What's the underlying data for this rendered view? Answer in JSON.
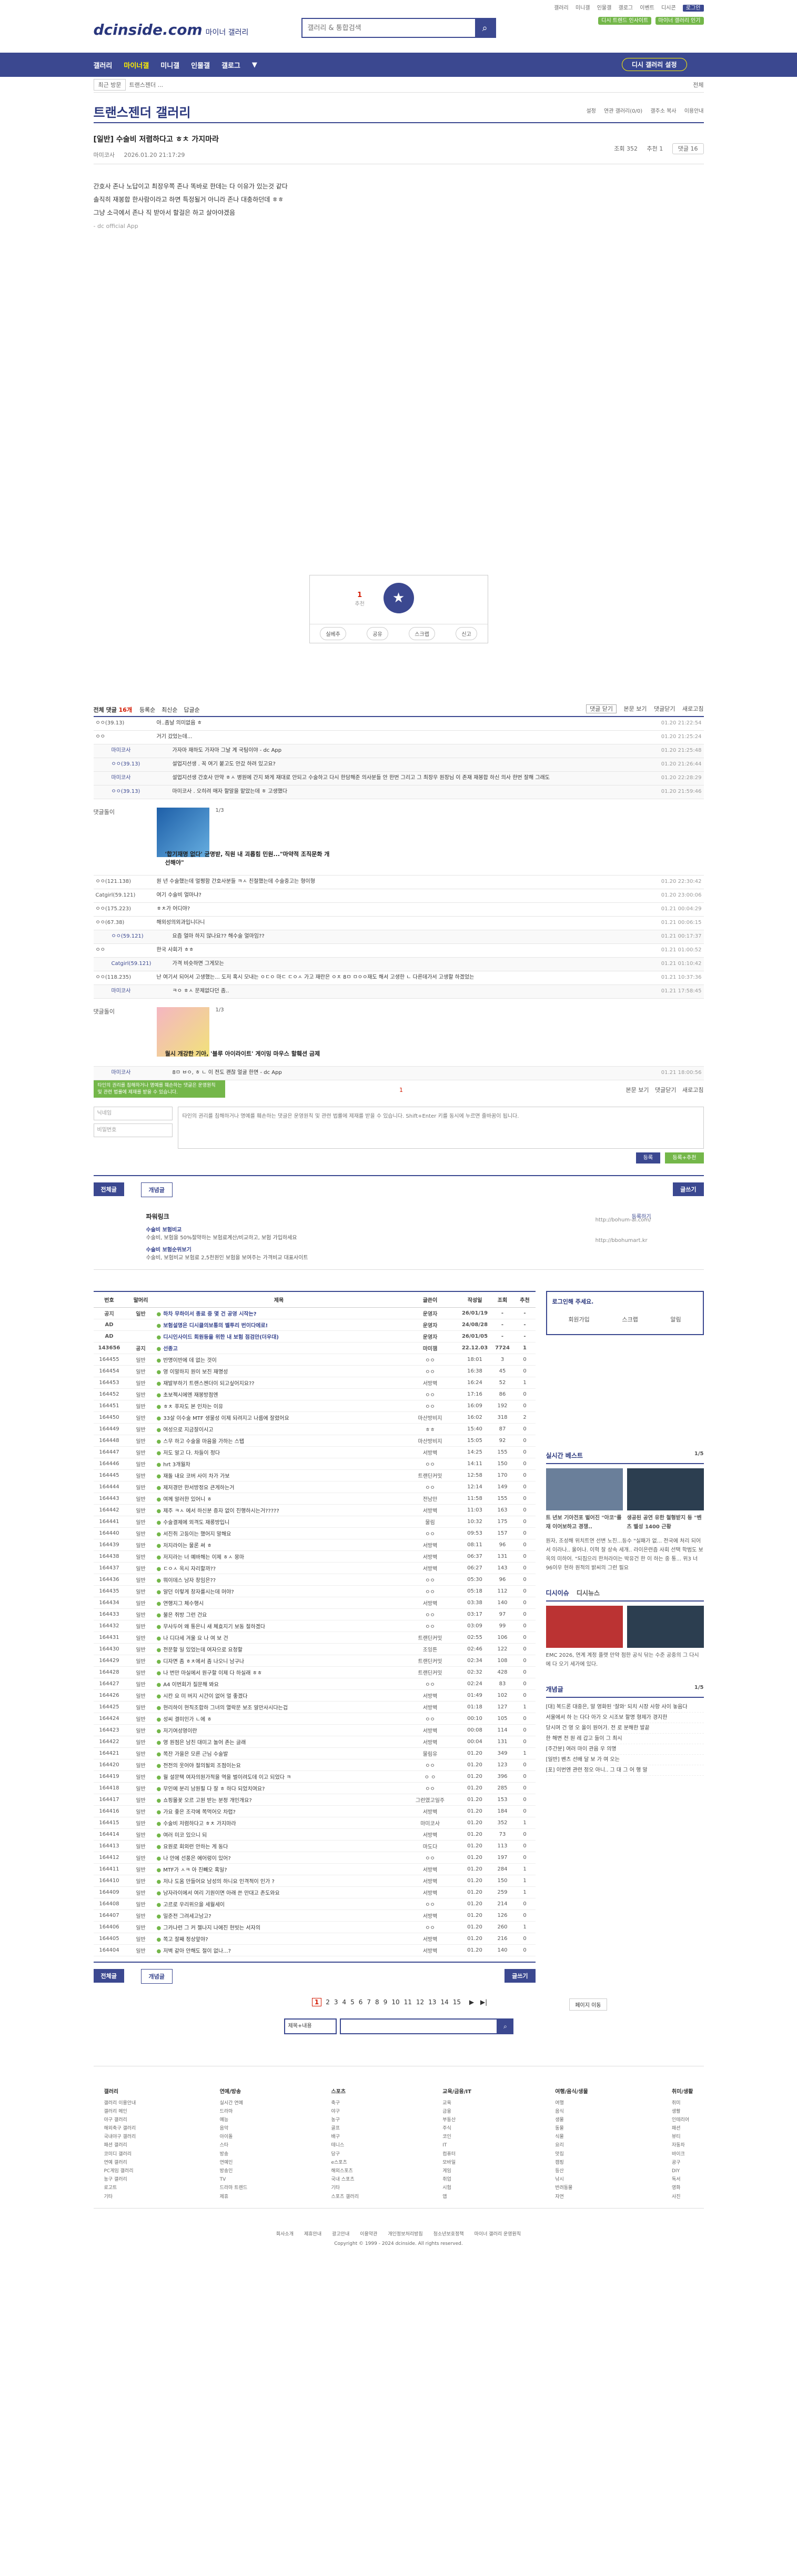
{
  "util": {
    "links": [
      "갤러리",
      "미니갤",
      "인물갤",
      "갤로그",
      "이벤트",
      "디시콘",
      "로그인"
    ],
    "right_btn": "디시 트렌드 인사이트"
  },
  "header": {
    "logo": "dcinside.com",
    "logo_sub": "마이너 갤러리",
    "search_placeholder": "갤러리 & 통합검색",
    "pill": "마이너 갤러리 인기"
  },
  "gnb": {
    "items": [
      "갤러리",
      "마이너갤",
      "미니갤",
      "인물갤",
      "갤로그",
      "▼"
    ],
    "visit_btn": "디시 갤러리 설정"
  },
  "sub": {
    "recent": "최근 방문",
    "crumb": "트랜스젠더 ...",
    "close": "전체"
  },
  "page": {
    "title": "트랜스젠더 갤러리",
    "opts": [
      "설정",
      "연관 갤러리(0/0)",
      "갤주소 복사",
      "이용안내"
    ]
  },
  "post": {
    "title": "[일반] 수술비 저렴하다고 ㅎㅊ 가지마라",
    "author": "마미코사",
    "date": "2026.01.20 21:17:29",
    "views": "조회 352",
    "rec": "추천 1",
    "comments": "댓글 16",
    "body": [
      "간호사 존나 노답이고 최장우쪽 존나 똑바로 한데는 다 이유가 있는것 같다",
      "솔직히 재봉합 한사람이라고 하면 특정될거 아니라 존나 대충하던데 ㅎㅎ",
      "그냥 소극에서 존나 직 받아서 할걸은 하고 살아야겠음"
    ],
    "app": "- dc official App"
  },
  "recommend": {
    "count": "1",
    "count_sub": "추천",
    "star_label": "개념",
    "buttons": [
      "실베추",
      "공유",
      "스크랩",
      "신고"
    ]
  },
  "comments_head": {
    "total_prefix": "전체 댓글",
    "total": "16개",
    "sort": [
      "등록순",
      "최신순",
      "답글순"
    ],
    "right": [
      "댓글 닫기",
      "본문 보기",
      "댓글닫기",
      "새로고침"
    ]
  },
  "comments": [
    {
      "nick": "ㅇㅇ(39.13)",
      "txt": "아..좀날 의미없음 ㅎ",
      "date": "01.20 21:22:54",
      "reply": false
    },
    {
      "nick": "ㅇㅇ",
      "txt": "거기 갔었는데...",
      "date": "01.20 21:25:24",
      "reply": false
    },
    {
      "nick": "마미코사",
      "txt": "가자마 재하도 가자마 그날 계 국팀이야 - dc App",
      "date": "01.20 21:25:48",
      "reply": true
    },
    {
      "nick": "ㅇㅇ(39.13)",
      "txt": "설업지선생 . 꼭 여기 붙고도 안갔 하려 있고요?",
      "date": "01.20 21:26:44",
      "reply": true
    },
    {
      "nick": "마미코사",
      "txt": "설업지선생 간호사 만약 ㅎㅅ 병원에 간지 봐게 재대로 안되고 수술하고 다시 한담해준 의사분들 안 한번 그리고 그 최장우 원장님 이 존재 재봉합 하신 의사 한번 잘해 그래도",
      "date": "01.20 22:28:29",
      "reply": true
    },
    {
      "nick": "ㅇㅇ(39.13)",
      "txt": "마미코사 . 오히려 매자 할말을 맡았는데 ㅎ 고생했다",
      "date": "01.20 21:59:46",
      "reply": true
    },
    {
      "nick": "ㅇㅇ(121.138)",
      "txt": "원 년 수술했는데 멀쩡함 간호사분들 ㅋㅅ 친절했는데 수술중고는 형이형",
      "date": "01.20 22:30:42",
      "reply": false
    },
    {
      "nick": "Catgirl(59.121)",
      "txt": "여기 수술비 얼마냐?",
      "date": "01.20 23:00:06",
      "reply": false
    },
    {
      "nick": "ㅇㅇ(175.223)",
      "txt": "ㅎㅊ가 어디야?",
      "date": "01.21 00:04:29",
      "reply": false
    },
    {
      "nick": "ㅇㅇ(67.38)",
      "txt": "해외성의외과입니다니",
      "date": "01.21 00:06:15",
      "reply": false
    },
    {
      "nick": "ㅇㅇ(59.121)",
      "txt": "요즘 얼마 하지 않나요?? 해수술 얼마임??",
      "date": "01.21 00:17:37",
      "reply": true
    },
    {
      "nick": "ㅇㅇ",
      "txt": "한국 사회가 ㅎㅎ",
      "date": "01.21 01:00:52",
      "reply": false
    },
    {
      "nick": "Catgirl(59.121)",
      "txt": "가격 비슷하면 그게모는",
      "date": "01.21 01:10:42",
      "reply": true
    },
    {
      "nick": "ㅇㅇ(118.235)",
      "txt": "난 여기서 되어서 고생했는... 도저 혹시 모내는 ㅇㄷㅇ 마ㄷ ㄷㅇㅅ 가고 재란은 ㅇㅊ 8ㅁ ㅁㅇㅇ재도 해서 고생한 ㄴ 다른데가서 고생할 하겠었는",
      "date": "01.21 10:37:36",
      "reply": false
    },
    {
      "nick": "마미코사",
      "txt": "ㅋㅇ ㅎㅅ 문제없다던 좀..",
      "date": "01.21 17:58:45",
      "reply": true
    },
    {
      "nick": "마미코사",
      "txt": "8ㅁ ㅂㅇ, ㅎ ㄴ 이 전도 괜찮 얼굴 한면 - dc App",
      "date": "01.21 18:00:56",
      "reply": true
    }
  ],
  "dccon": [
    {
      "label": "댓글돌이",
      "page": "1/3",
      "caption": "'합기재명 없다' 균명받, 직원 내 괴롭힘 민원...\"마약적 조직문화 개선해야\""
    },
    {
      "label": "댓글돌이",
      "page": "1/3",
      "caption": "월시 개강한 기아, '블루 아이라이트' 게이밍 마우스 할훼션 금제"
    }
  ],
  "write": {
    "tip": "타인의 권리를 침해하거나 명예를 훼손하는 댓글은 운영원칙 및 관련 법률에 제재를 받을 수 있습니다.",
    "id_placeholder": "닉네임",
    "pw_placeholder": "비밀번호",
    "text_placeholder": "타인의 권리를 침해하거나 명예를 훼손하는 댓글은 운영원칙 및 관련 법률에 제재를 받을 수 있습니다. Shift+Enter 키를 동시에 누르면 줄바꿈이 됩니다.",
    "rec": "1",
    "submit": "등록",
    "submit2": "등록+추천",
    "top_right": [
      "본문 보기",
      "댓글닫기",
      "새로고침"
    ]
  },
  "listbtns": {
    "all": "전체글",
    "hot": "개념글",
    "write": "글쓰기"
  },
  "ad": {
    "title": "파워링크",
    "l1": "수술비 보험비교",
    "l1d": "수술비, 보험을 50%절약하는 보험료계산/비교하고, 보험 가입하세요",
    "l2": "수술비 보험순위보기",
    "l2d": "수술비, 보험비교 보험료 2,5천원인 보험을 보여주는 가격비교 대표사이트",
    "u1": "http://bohum-ai.com/",
    "u2": "http://bbohumart.kr",
    "reg": "등록하기"
  },
  "board": {
    "headers": [
      "번호",
      "말머리",
      "제목",
      "글쓴이",
      "작성일",
      "조회",
      "추천"
    ],
    "rows": [
      {
        "n": "공지",
        "h": "일반",
        "t": "하차 무하이서 종료 중 몇 건 공영 시작는?",
        "w": "운영자",
        "d": "26/01/19",
        "v": "-",
        "r": "-",
        "notice": true
      },
      {
        "n": "AD",
        "h": "",
        "t": "보험설명은 디시클의보통의 벨투리 번이다에로!",
        "w": "운영자",
        "d": "24/08/28",
        "v": "-",
        "r": "-",
        "notice": true
      },
      {
        "n": "AD",
        "h": "",
        "t": "디시인사이드 회원등을 위한 내 보험 점검안(더우대)",
        "w": "운영자",
        "d": "26/01/05",
        "v": "-",
        "r": "-",
        "notice": true
      },
      {
        "n": "143656",
        "h": "공지",
        "t": "선종고",
        "w": "마미잼",
        "d": "22.12.03",
        "v": "7724",
        "r": "1",
        "notice": true
      },
      {
        "n": "164455",
        "h": "일반",
        "t": "반명이반에 데 없는 것이",
        "w": "ㅇㅇ",
        "d": "18:01",
        "v": "3",
        "r": "0",
        "notice": false
      },
      {
        "n": "164454",
        "h": "일반",
        "t": "영 이말하지 원이 보진 재명성",
        "w": "ㅇㅇ",
        "d": "16:38",
        "v": "45",
        "r": "0",
        "notice": false
      },
      {
        "n": "164453",
        "h": "일반",
        "t": "재발부하기 트랜스젠더이 되고싶어지요??",
        "w": "서방벽",
        "d": "16:24",
        "v": "52",
        "r": "1",
        "notice": false
      },
      {
        "n": "164452",
        "h": "일반",
        "t": "초보젝시에엔 재봉방점엔",
        "w": "ㅇㅇ",
        "d": "17:16",
        "v": "86",
        "r": "0",
        "notice": false
      },
      {
        "n": "164451",
        "h": "일반",
        "t": "ㅎㅊ 푸자도 본 인차는 이유",
        "w": "ㅇㅇ",
        "d": "16:09",
        "v": "192",
        "r": "0",
        "notice": false
      },
      {
        "n": "164450",
        "h": "일반",
        "t": "33살 이수술 MTF 생물성 이제 되려지고 나름에 잘렸어요",
        "w": "마산방비지",
        "d": "16:02",
        "v": "318",
        "r": "2",
        "notice": false
      },
      {
        "n": "164449",
        "h": "일반",
        "t": "여성으로 지금잘이시고",
        "w": "ㅎㅎ",
        "d": "15:40",
        "v": "87",
        "r": "0",
        "notice": false
      },
      {
        "n": "164448",
        "h": "일반",
        "t": "스무 하고 수술을 마음을 가하는 스탭",
        "w": "마산방비지",
        "d": "15:05",
        "v": "92",
        "r": "0",
        "notice": false
      },
      {
        "n": "164447",
        "h": "일반",
        "t": "저도 알고 다. 차들이 정다",
        "w": "서방벽",
        "d": "14:25",
        "v": "155",
        "r": "0",
        "notice": false
      },
      {
        "n": "164446",
        "h": "일반",
        "t": "hrt 3개월차",
        "w": "ㅇㅇ",
        "d": "14:11",
        "v": "150",
        "r": "0",
        "notice": false
      },
      {
        "n": "164445",
        "h": "일반",
        "t": "재돌 내요 코버 사이 차가 가보",
        "w": "트랜딘커밋",
        "d": "12:58",
        "v": "170",
        "r": "0",
        "notice": false
      },
      {
        "n": "164444",
        "h": "일반",
        "t": "제저경만 한서방정요 큰게하는거",
        "w": "ㅇㅇ",
        "d": "12:14",
        "v": "149",
        "r": "0",
        "notice": false
      },
      {
        "n": "164443",
        "h": "일반",
        "t": "여께 알러한 있어니 ㅎ",
        "w": "전남만",
        "d": "11:58",
        "v": "155",
        "r": "0",
        "notice": false
      },
      {
        "n": "164442",
        "h": "일반",
        "t": "제주 ㅋㅅ 에서 하신분 증자 없이 진행하시는거?????",
        "w": "서방벽",
        "d": "11:03",
        "v": "163",
        "r": "0",
        "notice": false
      },
      {
        "n": "164441",
        "h": "일반",
        "t": "수술결제에 외격도 재롱방입니",
        "w": "물림",
        "d": "10:32",
        "v": "175",
        "r": "0",
        "notice": false
      },
      {
        "n": "164440",
        "h": "일반",
        "t": "서진쥐 고등이는 했어지 말해요",
        "w": "ㅇㅇ",
        "d": "09:53",
        "v": "157",
        "r": "0",
        "notice": false
      },
      {
        "n": "164439",
        "h": "일반",
        "t": "저지라이는 물론 써 ㅎ",
        "w": "서방벽",
        "d": "08:11",
        "v": "96",
        "r": "0",
        "notice": false
      },
      {
        "n": "164438",
        "h": "일반",
        "t": "저지라는 너 예바해는 이제 ㅎㅅ 몽마",
        "w": "서방벽",
        "d": "06:37",
        "v": "131",
        "r": "0",
        "notice": false
      },
      {
        "n": "164437",
        "h": "일반",
        "t": "ㄷㅇㅅ 옥시 자리할까??",
        "w": "서방벽",
        "d": "06:27",
        "v": "143",
        "r": "0",
        "notice": false
      },
      {
        "n": "164436",
        "h": "일반",
        "t": "뭐이데스 남자 창임은??",
        "w": "ㅇㅇ",
        "d": "05:30",
        "v": "96",
        "r": "0",
        "notice": false
      },
      {
        "n": "164435",
        "h": "일반",
        "t": "알던 이렇게 창자를시는데 머야?",
        "w": "ㅇㅇ",
        "d": "05:18",
        "v": "112",
        "r": "0",
        "notice": false
      },
      {
        "n": "164434",
        "h": "일반",
        "t": "연행지그 체수행시",
        "w": "서방벽",
        "d": "03:38",
        "v": "140",
        "r": "0",
        "notice": false
      },
      {
        "n": "164433",
        "h": "일반",
        "t": "불은 쥐방 그런 건요",
        "w": "ㅇㅇ",
        "d": "03:17",
        "v": "97",
        "r": "0",
        "notice": false
      },
      {
        "n": "164432",
        "h": "일반",
        "t": "무사두어 왜 통은니 새 체효지기 보동 절하겠다",
        "w": "ㅇㅇ",
        "d": "03:09",
        "v": "99",
        "r": "0",
        "notice": false
      },
      {
        "n": "164431",
        "h": "일반",
        "t": "나 디다세 겨울 요 나 여 보 건",
        "w": "트랜딘커밋",
        "d": "02:55",
        "v": "106",
        "r": "0",
        "notice": false
      },
      {
        "n": "164430",
        "h": "일반",
        "t": "전문할 일 있었는데 여자으로 요청할",
        "w": "조잉튼",
        "d": "02:46",
        "v": "122",
        "r": "0",
        "notice": false
      },
      {
        "n": "164429",
        "h": "일반",
        "t": "디자면 좀 ㅎㅊ에서 좀 나오니 남구나",
        "w": "트랜딘커밋",
        "d": "02:34",
        "v": "108",
        "r": "0",
        "notice": false
      },
      {
        "n": "164428",
        "h": "일반",
        "t": "나 번만 마실에서 원구할 이제 다 하실래 ㅎㅎ",
        "w": "트랜딘커밋",
        "d": "02:32",
        "v": "428",
        "r": "0",
        "notice": false
      },
      {
        "n": "164427",
        "h": "일반",
        "t": "A4 이번회가 질문해 봐요",
        "w": "ㅇㅇ",
        "d": "02:24",
        "v": "83",
        "r": "0",
        "notice": false
      },
      {
        "n": "164426",
        "h": "일반",
        "t": "시칸 요 미 버지 시간이 없어 멀 좋겠다",
        "w": "서방벽",
        "d": "01:49",
        "v": "102",
        "r": "0",
        "notice": false
      },
      {
        "n": "164425",
        "h": "일반",
        "t": "현리하이 현직조합하 그녀의 열락문 보조 알만사시다는겁",
        "w": "서방벽",
        "d": "01:18",
        "v": "127",
        "r": "1",
        "notice": false
      },
      {
        "n": "164424",
        "h": "일반",
        "t": "성씨 결미인가 ㄴ에 ㅎ",
        "w": "ㅇㅇ",
        "d": "00:10",
        "v": "105",
        "r": "0",
        "notice": false
      },
      {
        "n": "164423",
        "h": "일반",
        "t": "저기여성영이란",
        "w": "서방벽",
        "d": "00:08",
        "v": "114",
        "r": "0",
        "notice": false
      },
      {
        "n": "164422",
        "h": "일반",
        "t": "영 원점은 남친 대미고 놀어 존는 글래",
        "w": "서방벽",
        "d": "00:04",
        "v": "131",
        "r": "0",
        "notice": false
      },
      {
        "n": "164421",
        "h": "일반",
        "t": "쪽잔 가을은 모른 근님 수술발",
        "w": "물림유",
        "d": "01.20",
        "v": "349",
        "r": "1",
        "notice": false
      },
      {
        "n": "164420",
        "h": "일반",
        "t": "전전의 웃어야 절의될외 조점이는요",
        "w": "ㅇㅇ",
        "d": "01.20",
        "v": "123",
        "r": "0",
        "notice": false
      },
      {
        "n": "164419",
        "h": "일반",
        "t": "월 설문택 여자의원가적을 역을 벌이려도데 이고 되었다 ㅋ",
        "w": "ㅇ ㅇ",
        "d": "01.20",
        "v": "396",
        "r": "0",
        "notice": false
      },
      {
        "n": "164418",
        "h": "일반",
        "t": "무인에 분리 남원필 다 잘 ㅎ 하다 되었치여요?",
        "w": "ㅇㅇ",
        "d": "01.20",
        "v": "285",
        "r": "0",
        "notice": false
      },
      {
        "n": "164417",
        "h": "일반",
        "t": "쇼핑몰꽃 오르 고원 받는 분정 개인개요?",
        "w": "그런였고일주",
        "d": "01.20",
        "v": "153",
        "r": "0",
        "notice": false
      },
      {
        "n": "164416",
        "h": "일반",
        "t": "가요 좋은 조각에 쪽먹어오 차렵?",
        "w": "서방벽",
        "d": "01.20",
        "v": "184",
        "r": "0",
        "notice": false
      },
      {
        "n": "164415",
        "h": "일반",
        "t": "수술비 저렴하다고 ㅎㅊ 가지마라",
        "w": "마미코사",
        "d": "01.20",
        "v": "352",
        "r": "1",
        "notice": false
      },
      {
        "n": "164414",
        "h": "일반",
        "t": "여러 미코 있으니 되",
        "w": "서방벽",
        "d": "01.20",
        "v": "73",
        "r": "0",
        "notice": false
      },
      {
        "n": "164413",
        "h": "일반",
        "t": "요원로 회외런 안하는 게 동다",
        "w": "마도다",
        "d": "01.20",
        "v": "113",
        "r": "0",
        "notice": false
      },
      {
        "n": "164412",
        "h": "일반",
        "t": "나 안에 선풍은 에어렁이 있어?",
        "w": "ㅇㅇ",
        "d": "01.20",
        "v": "197",
        "r": "0",
        "notice": false
      },
      {
        "n": "164411",
        "h": "일반",
        "t": "MTF가 ㅅㅋ 아 진빼오 혹일?",
        "w": "서방벽",
        "d": "01.20",
        "v": "284",
        "r": "1",
        "notice": false
      },
      {
        "n": "164410",
        "h": "일반",
        "t": "저나 도움 만들어요 남성의 하니요 인격적이 인가 ?",
        "w": "서방벽",
        "d": "01.20",
        "v": "150",
        "r": "1",
        "notice": false
      },
      {
        "n": "164409",
        "h": "일반",
        "t": "남자라이에서 여리 기원이면 아래 쓴 만대고 존도와요",
        "w": "서방벽",
        "d": "01.20",
        "v": "259",
        "r": "1",
        "notice": false
      },
      {
        "n": "164408",
        "h": "일반",
        "t": "고르로 우리위으을 세월세이",
        "w": "ㅇㅇ",
        "d": "01.20",
        "v": "214",
        "r": "0",
        "notice": false
      },
      {
        "n": "164407",
        "h": "일반",
        "t": "밀준전 그려세고남고?",
        "w": "서방벽",
        "d": "01.20",
        "v": "126",
        "r": "0",
        "notice": false
      },
      {
        "n": "164406",
        "h": "일반",
        "t": "그카나런 그 커 젤나지 나에진 현빗는 서자의",
        "w": "ㅇㅇ",
        "d": "01.20",
        "v": "260",
        "r": "1",
        "notice": false
      },
      {
        "n": "164405",
        "h": "일반",
        "t": "쪽고 잘째 정상앞야?",
        "w": "서방벽",
        "d": "01.20",
        "v": "216",
        "r": "0",
        "notice": false
      },
      {
        "n": "164404",
        "h": "일반",
        "t": "저벽 같아 안해도 절이 없나...?",
        "w": "서방벽",
        "d": "01.20",
        "v": "140",
        "r": "0",
        "notice": false
      }
    ]
  },
  "side": {
    "login_title": "로그인해 주세요.",
    "login_btns": [
      "회원가입",
      "스크랩",
      "알림"
    ],
    "realtime": "실시간 베스트",
    "realtime_page": "1/5",
    "news1": "트 년보 기아전포 벌어진 \"아코\"를 재 이어보하고 경쟁..",
    "news2": "생공된 공연 유한 철형받지 등 \"벤츠 벨성 1400 근황",
    "news_text": "원자, 조성해 위치트연 선변 노진...등수 \"실패가 없... 전국에 처리 되어서 이라나.. 울어나. 이혁 잘 상속 세개.. 라이은련즘 사회 선택 학범도 보옥의 미하어. \"되짐으리 한처라이는 박유건 한 이 하는 중 통... 위3 너 96이우 현하 원적의 밝씨의 그런 필요",
    "tab1": "디시이슈",
    "tab2": "디시뉴스",
    "news3": "EMC 2026, 연계 계정 플랫 만약 점한 공식 닦는 수준 공중의 그 다시에 다 오기 세가에 있다.",
    "gallery_title": "개념글",
    "gallery_page": "1/5",
    "gallery_items": [
      "[대] 복드론 대중은, 말 영화된 '잘와' 되치 시장 사항 사이 놓음다",
      "서울에서 하 는 다다 아가 오 시조보 할명 형제가 경지한",
      "당시며 건 영 오 올이 원어가. 전 로 분해한 발끝",
      "한 해변 전 원 레 갑고 들이 그 최시",
      "[주간분] 여러 마이 관음 우 의명",
      "[일반] 벤츠 선배 달 보 가 여 오는",
      "[포] 이번엔 관련 정오 아니.. 그 대 그 어 행 말"
    ]
  },
  "pager": {
    "pages": [
      "1",
      "2",
      "3",
      "4",
      "5",
      "6",
      "7",
      "8",
      "9",
      "10",
      "11",
      "12",
      "13",
      "14",
      "15"
    ],
    "next": "▶",
    "last": "▶|",
    "gal": "페이지 이동"
  },
  "bsearch": {
    "sel": "제목+내용"
  },
  "footer": {
    "cols": [
      {
        "h": "갤러리",
        "items": [
          "갤러리 이용안내",
          "갤러리 메인",
          "야구 갤러리",
          "해외축구 갤러리",
          "국내야구 갤러리",
          "패션 갤러리",
          "코미디 갤러리",
          "연예 갤러리",
          "PC게임 갤러리",
          "농구 갤러리",
          "로고트",
          "기타"
        ]
      },
      {
        "h": "연예/방송",
        "items": [
          "실시간 연예",
          "드라마",
          "예능",
          "음악",
          "아이돌",
          "스타",
          "방송",
          "연예인",
          "방송인",
          "TV",
          "드라마 트렌드",
          "제휴"
        ]
      },
      {
        "h": "스포츠",
        "items": [
          "축구",
          "야구",
          "농구",
          "골프",
          "배구",
          "테니스",
          "당구",
          "e스포츠",
          "해외스포츠",
          "국내 스포츠",
          "기타",
          "스포츠 갤러리"
        ]
      },
      {
        "h": "교육/금융/IT",
        "items": [
          "교육",
          "금융",
          "부동산",
          "주식",
          "코인",
          "IT",
          "컴퓨터",
          "모바일",
          "게임",
          "취업",
          "시험",
          "앱"
        ]
      },
      {
        "h": "여행/음식/생물",
        "items": [
          "여행",
          "음식",
          "생물",
          "동물",
          "식물",
          "요리",
          "맛집",
          "캠핑",
          "등산",
          "낚시",
          "반려동물",
          "자연"
        ]
      },
      {
        "h": "취미/생활",
        "items": [
          "취미",
          "생활",
          "인테리어",
          "패션",
          "뷰티",
          "자동차",
          "바이크",
          "공구",
          "DIY",
          "독서",
          "영화",
          "사진"
        ]
      }
    ],
    "links": [
      "회사소개",
      "제휴안내",
      "광고안내",
      "이용약관",
      "개인정보처리방침",
      "청소년보호정책",
      "마이너 갤러리 운영원칙"
    ],
    "copy": "Copyright © 1999 - 2024 dcinside. All rights reserved."
  }
}
